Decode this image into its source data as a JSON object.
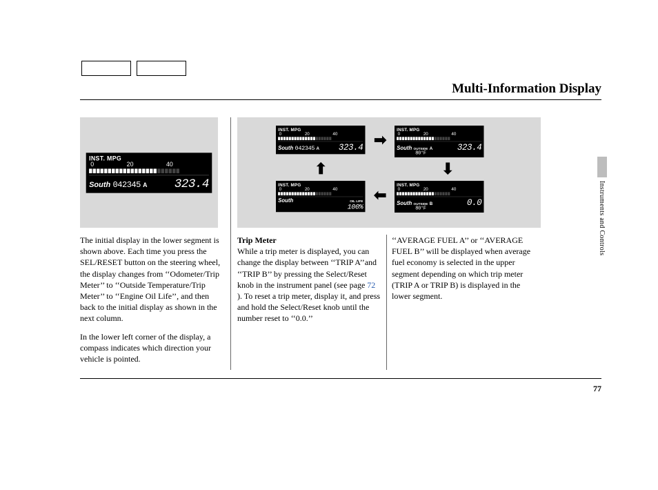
{
  "title": "Multi-Information Display",
  "side_section": "Instruments and Controls",
  "page_number": "77",
  "link_page": "72",
  "lcd": {
    "inst_mpg": "INST. MPG",
    "scale": {
      "a": "0",
      "b": "20",
      "c": "40"
    },
    "south": "South",
    "odo": "042345",
    "trip_a_label": "A",
    "trip_b_label": "B",
    "trip_val": "323.4",
    "trip_zero": "0.0",
    "outside": "OUTSIDE",
    "temp": "80°F",
    "oil_life": "OIL LIFE",
    "oil_pct": "100%"
  },
  "col1": {
    "p1": "The initial display in the lower segment is shown above. Each time you press the SEL/RESET button on the steering wheel, the display changes from ‘‘Odometer/Trip Meter’’ to ‘‘Outside Temperature/Trip Meter’’ to ‘‘Engine Oil Life’’, and then back to the initial display as shown in the next column.",
    "p2": "In the lower left corner of the display, a compass indicates which direction your vehicle is pointed."
  },
  "col2": {
    "heading": "Trip Meter",
    "p1a": "While a trip meter is displayed, you can change the display between ‘‘TRIP A’’and ‘‘TRIP B’’ by pressing the Select/Reset knob in the instrument panel (see page ",
    "p1b": " ). To reset a trip meter, display it, and press and hold the Select/Reset knob until the number reset to ‘‘0.0.’’"
  },
  "col3": {
    "p1": "‘‘AVERAGE FUEL A’’ or ‘‘AVERAGE FUEL B’’ will be displayed when average fuel economy is selected in the upper segment depending on which trip meter (TRIP A or TRIP B) is displayed in the lower segment."
  }
}
